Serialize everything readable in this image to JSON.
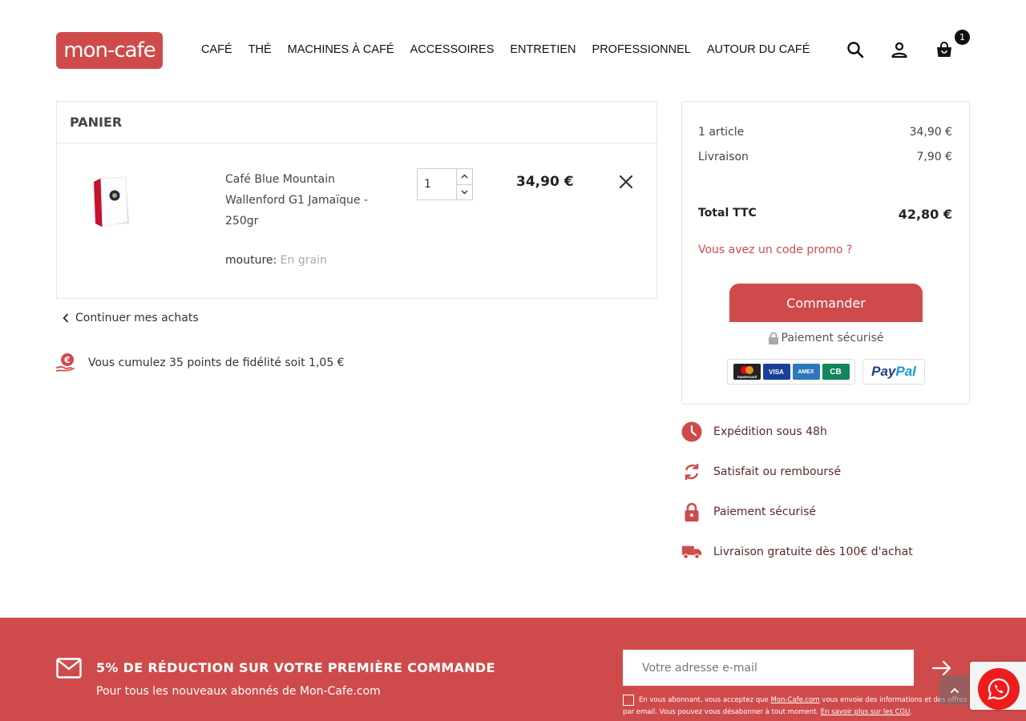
{
  "header": {
    "logo_text": "mon-cafe",
    "nav": [
      "CAFÉ",
      "THÉ",
      "MACHINES À CAFÉ",
      "ACCESSOIRES",
      "ENTRETIEN",
      "PROFESSIONNEL",
      "AUTOUR DU CAFÉ"
    ],
    "cart_count": "1"
  },
  "cart": {
    "title": "PANIER",
    "item": {
      "name": "Café Blue Mountain Wallenford G1 Jamaïque - 250gr",
      "attr_label": "mouture:",
      "attr_value": "En grain",
      "quantity": "1",
      "price": "34,90 €"
    },
    "continue_label": "Continuer mes achats",
    "fidelity_text": "Vous cumulez 35 points de fidélité soit 1,05 €"
  },
  "summary": {
    "articles_label": "1 article",
    "articles_value": "34,90 €",
    "shipping_label": "Livraison",
    "shipping_value": "7,90 €",
    "total_label": "Total TTC",
    "total_value": "42,80 €",
    "promo_label": "Vous avez un code promo ?",
    "order_button": "Commander",
    "secure_label": "Paiement sécurisé",
    "cards": [
      "mastercard",
      "VISA",
      "AMEX",
      "CB"
    ],
    "paypal_a": "Pay",
    "paypal_b": "Pal"
  },
  "reassurance": [
    {
      "icon": "clock-icon",
      "label": "Expédition sous 48h"
    },
    {
      "icon": "refresh-icon",
      "label": "Satisfait ou remboursé"
    },
    {
      "icon": "lock-icon",
      "label": "Paiement sécurisé"
    },
    {
      "icon": "truck-icon",
      "label": "Livraison gratuite dès 100€ d'achat"
    }
  ],
  "newsletter": {
    "title": "5% DE RÉDUCTION SUR VOTRE PREMIÈRE COMMANDE",
    "subtitle": "Pour tous les nouveaux abonnés de Mon-Cafe.com",
    "placeholder": "Votre adresse e-mail",
    "legal_1": "En vous abonnant, vous acceptez que ",
    "legal_link_1": "Mon-Cafe.com",
    "legal_2": " vous envoie des informations et des offres par email. Vous pouvez vous désabonner à tout moment. ",
    "legal_link_2": "En savoir plus sur les CGU",
    "legal_3": "."
  },
  "colors": {
    "brand": "#cf4b4b",
    "dark": "#222222"
  }
}
